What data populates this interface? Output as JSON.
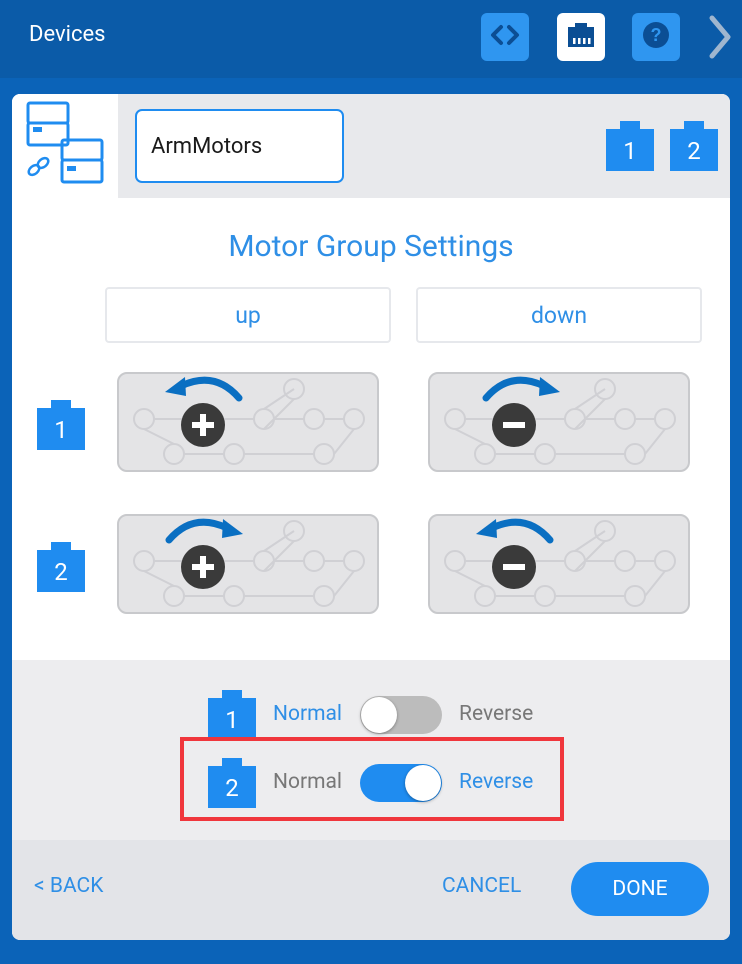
{
  "app": {
    "title": "Devices"
  },
  "toolbar": {
    "items": [
      {
        "icon": "code-icon",
        "active": false
      },
      {
        "icon": "port-icon",
        "active": true
      },
      {
        "icon": "help-icon",
        "active": false
      }
    ],
    "next_icon": "chevron-right-icon"
  },
  "group": {
    "icon": "motor-group-icon",
    "name": "ArmMotors",
    "ports": [
      "1",
      "2"
    ]
  },
  "settings": {
    "title": "Motor Group Settings",
    "directions": {
      "forward": "up",
      "reverse": "down"
    },
    "motors": [
      {
        "port": "1",
        "up": {
          "arrow": "counter-clockwise",
          "sign": "plus"
        },
        "down": {
          "arrow": "clockwise",
          "sign": "minus"
        }
      },
      {
        "port": "2",
        "up": {
          "arrow": "clockwise",
          "sign": "plus"
        },
        "down": {
          "arrow": "counter-clockwise",
          "sign": "minus"
        }
      }
    ]
  },
  "reverse_settings": {
    "rows": [
      {
        "port": "1",
        "normal_label": "Normal",
        "reverse_label": "Reverse",
        "reversed": false
      },
      {
        "port": "2",
        "normal_label": "Normal",
        "reverse_label": "Reverse",
        "reversed": true
      }
    ]
  },
  "footer": {
    "back_label": "< BACK",
    "cancel_label": "CANCEL",
    "done_label": "DONE"
  },
  "colors": {
    "accent": "#1f8cf0",
    "header": "#0b5ba8",
    "highlight": "#f0363c",
    "toggle_off": "#bcbcbc",
    "inactive_text": "#777777"
  }
}
